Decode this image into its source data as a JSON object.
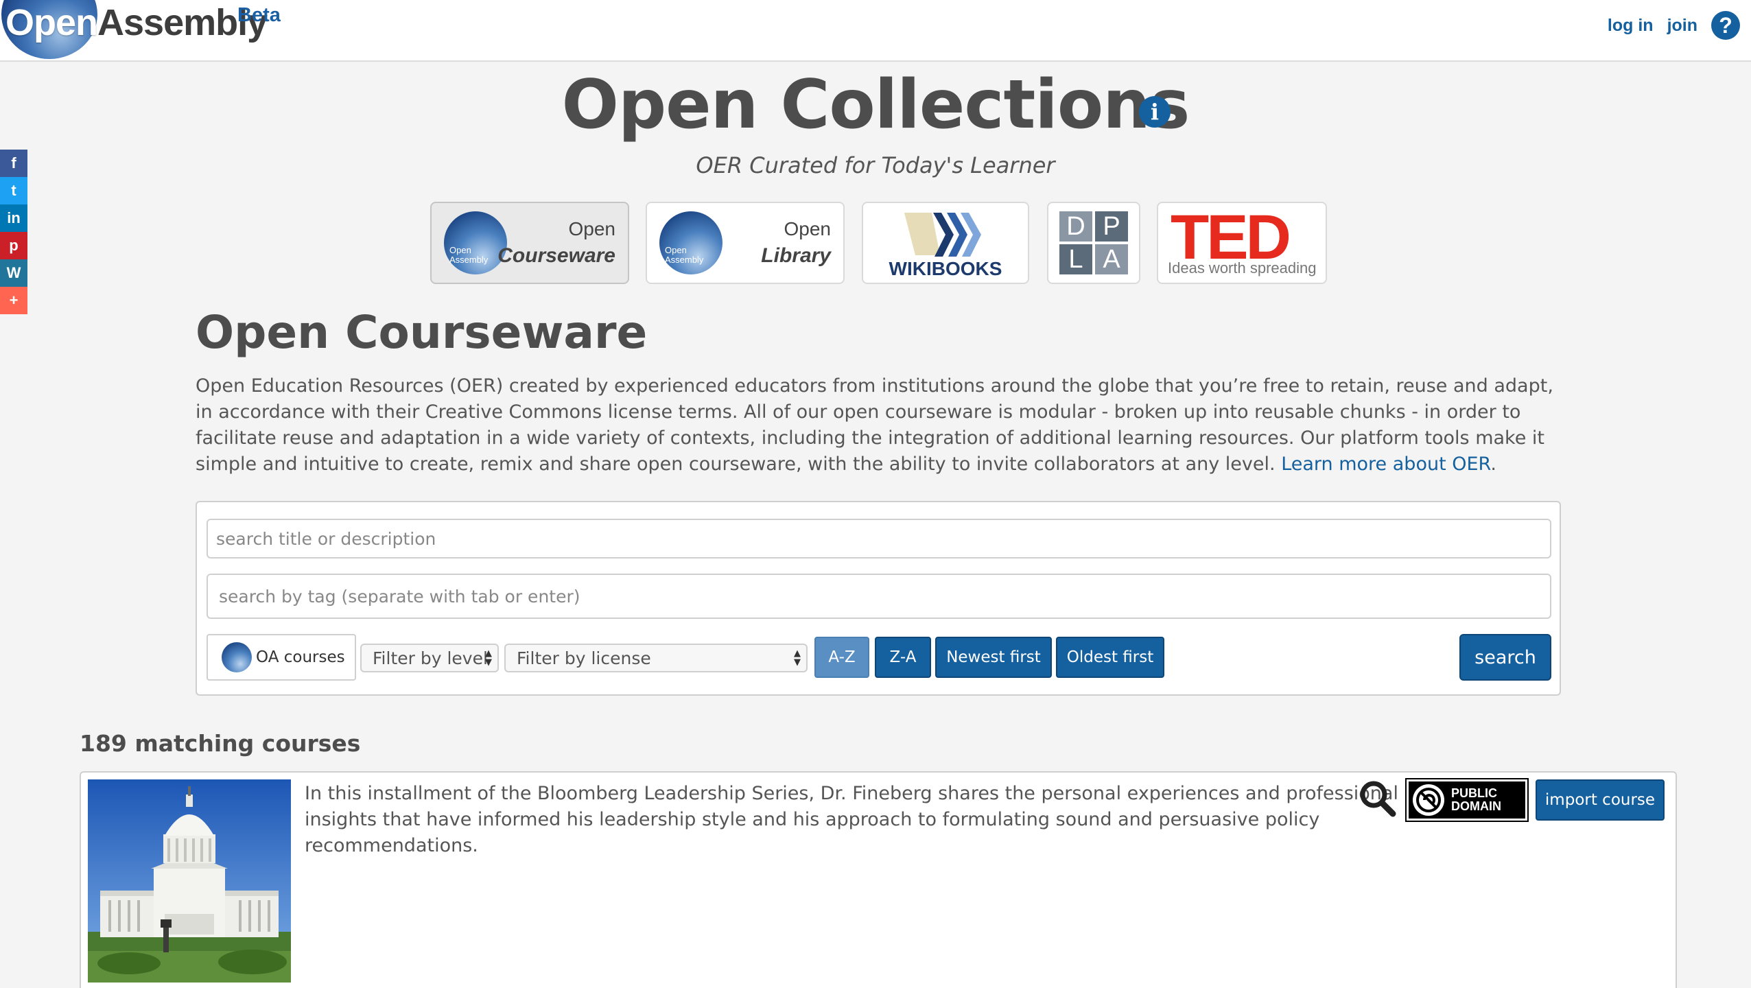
{
  "topbar": {
    "logo_part1": "Open",
    "logo_part2": "Assembly",
    "logo_beta": "Beta",
    "login_label": "log in",
    "join_label": "join",
    "help_label": "?"
  },
  "share": [
    {
      "name": "facebook",
      "glyph": "f",
      "color": "#3b5998"
    },
    {
      "name": "twitter",
      "glyph": "t",
      "color": "#1da1f2"
    },
    {
      "name": "linkedin",
      "glyph": "in",
      "color": "#0077b5"
    },
    {
      "name": "pinterest",
      "glyph": "p",
      "color": "#cb2027"
    },
    {
      "name": "wordpress",
      "glyph": "W",
      "color": "#21759b"
    },
    {
      "name": "more",
      "glyph": "+",
      "color": "#ff6550"
    }
  ],
  "header": {
    "title": "Open Collections",
    "info_glyph": "i",
    "subtitle": "OER Curated for Today's Learner"
  },
  "tiles": {
    "courseware": {
      "globe_text": "Open Assembly",
      "line1": "Open",
      "line2": "Courseware"
    },
    "library": {
      "globe_text": "Open Assembly",
      "line1": "Open",
      "line2": "Library"
    },
    "wikibooks": {
      "label": "WIKIBOOKS"
    },
    "dpla": {
      "letters": [
        "D",
        "P",
        "L",
        "A"
      ]
    },
    "ted": {
      "logo": "TED",
      "tagline": "Ideas worth spreading"
    }
  },
  "section": {
    "title": "Open Courseware",
    "description": "Open Education Resources (OER) created by experienced educators from institutions around the globe that you’re free to retain, reuse and adapt, in accordance with their Creative Commons license terms. All of our open courseware is modular - broken up into reusable chunks - in order to facilitate reuse and adaptation in a wide variety of contexts, including the integration of additional learning resources. Our platform tools make it simple and intuitive to create, remix and share open courseware, with the ability to invite collaborators at any level.",
    "learn_more": "Learn more about OER",
    "learn_more_suffix": "."
  },
  "search": {
    "title_placeholder": "search title or description",
    "tag_placeholder": "search by tag (separate with tab or enter)",
    "oa_toggle_label": "OA courses",
    "level_filter": "Filter by level",
    "license_filter": "Filter by license",
    "sort_az": "A-Z",
    "sort_za": "Z-A",
    "sort_newest": "Newest first",
    "sort_oldest": "Oldest first",
    "search_button": "search"
  },
  "results": {
    "count_text": "189 matching courses",
    "items": [
      {
        "description": "In this installment of the Bloomberg Leadership Series, Dr. Fineberg shares the personal experiences and professional insights that have informed his leadership style and his approach to formulating sound and persuasive policy recommendations.",
        "license": "PUBLIC DOMAIN",
        "license_line1": "PUBLIC",
        "license_line2": "DOMAIN",
        "import_label": "import course"
      }
    ]
  },
  "colors": {
    "brand_blue": "#15609e",
    "active_sort": "#5a8fc3",
    "ted_red": "#e62b1e",
    "dpla_gray": "#6c7a89"
  }
}
